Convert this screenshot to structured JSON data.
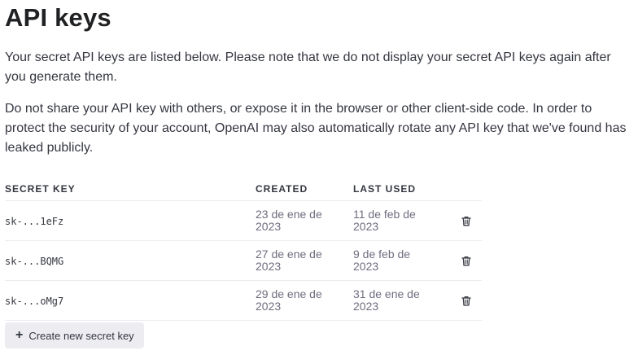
{
  "page": {
    "title": "API keys",
    "intro_1": "Your secret API keys are listed below. Please note that we do not display your secret API keys again after you generate them.",
    "intro_2": "Do not share your API key with others, or expose it in the browser or other client-side code. In order to protect the security of your account, OpenAI may also automatically rotate any API key that we've found has leaked publicly."
  },
  "table": {
    "headers": {
      "secret_key": "SECRET KEY",
      "created": "CREATED",
      "last_used": "LAST USED"
    },
    "rows": [
      {
        "key": "sk-...1eFz",
        "created": "23 de ene de 2023",
        "last_used": "11 de feb de 2023"
      },
      {
        "key": "sk-...BQMG",
        "created": "27 de ene de 2023",
        "last_used": "9 de feb de 2023"
      },
      {
        "key": "sk-...oMg7",
        "created": "29 de ene de 2023",
        "last_used": "31 de ene de 2023"
      }
    ],
    "row_action_icon": "trash-icon"
  },
  "actions": {
    "create_label": "Create new secret key",
    "create_icon": "plus-icon"
  },
  "colors": {
    "text_primary": "#353740",
    "text_secondary": "#6e6e80",
    "divider": "#ececf1",
    "button_bg": "#ececf1"
  }
}
